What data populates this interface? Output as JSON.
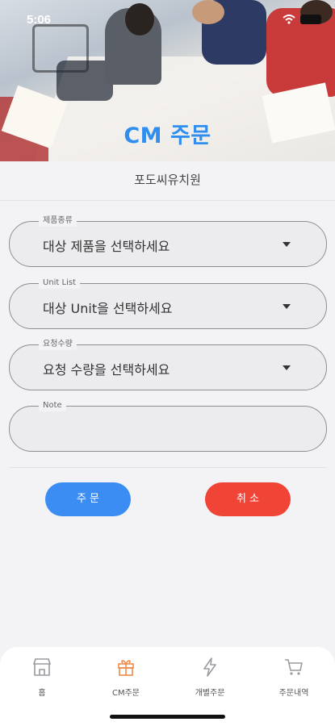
{
  "status": {
    "time": "5:06"
  },
  "hero": {
    "title": "CM 주문"
  },
  "school": "포도씨유치원",
  "form": {
    "product": {
      "label": "제품종류",
      "value": "대상 제품을 선택하세요"
    },
    "unit": {
      "label": "Unit List",
      "value": "대상 Unit을 선택하세요"
    },
    "quantity": {
      "label": "요청수량",
      "value": "요청 수량을 선택하세요"
    },
    "note": {
      "label": "Note",
      "value": ""
    }
  },
  "buttons": {
    "order": "주 문",
    "cancel": "취 소"
  },
  "tabs": [
    {
      "label": "홈",
      "icon": "store-icon"
    },
    {
      "label": "CM주문",
      "icon": "gift-icon"
    },
    {
      "label": "개별주문",
      "icon": "lightning-icon"
    },
    {
      "label": "주문내역",
      "icon": "cart-icon"
    }
  ],
  "colors": {
    "accent": "#3b8cf3",
    "danger": "#f04437",
    "active_tab": "#f08a4b",
    "title": "#2f8ef0"
  }
}
